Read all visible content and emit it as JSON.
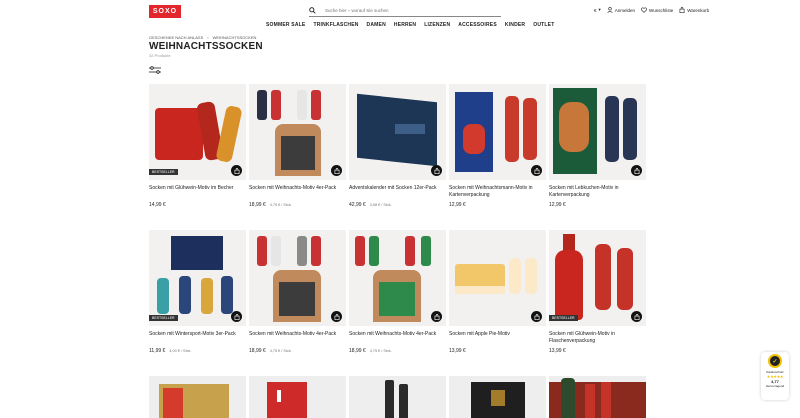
{
  "header": {
    "logo": "SOXO",
    "search_placeholder": "Suche hier – worauf Sie suchen",
    "currency": "€",
    "login": "Anmelden",
    "wishlist": "Wunschliste",
    "cart": "Warenkorb"
  },
  "nav": [
    "SOMMER SALE",
    "TRINKFLASCHEN",
    "DAMEN",
    "HERREN",
    "LIZENZEN",
    "ACCESSOIRES",
    "KINDER",
    "OUTLET"
  ],
  "breadcrumb": [
    "GESCHENKE NACH ANLASS",
    "WEIHNACHTSSOCKEN"
  ],
  "page_title": "WEIHNACHTSSOCKEN",
  "product_count": "32 Produkte",
  "colors": {
    "brand": "#e2262b",
    "bag": "#111111"
  },
  "products": [
    {
      "name": "Socken mit Glühwein-Motiv im Becher",
      "price": "14,99 €",
      "unit": "",
      "badge": "BESTSELLER"
    },
    {
      "name": "Socken mit Weihnachts-Motiv 4er-Pack",
      "price": "18,99 €",
      "unit": "4,75 € / Stck.",
      "badge": ""
    },
    {
      "name": "Adventskalender mit Socken 12er-Pack",
      "price": "42,99 €",
      "unit": "3,58 € / Stck.",
      "badge": ""
    },
    {
      "name": "Socken mit Weihnachtsmann-Motiv in Kartenverpackung",
      "price": "12,99 €",
      "unit": "",
      "badge": ""
    },
    {
      "name": "Socken mit Lebkuchen-Motiv in Kartenverpackung",
      "price": "12,99 €",
      "unit": "",
      "badge": ""
    },
    {
      "name": "Socken mit Wintersport-Motiv 3er-Pack",
      "price": "11,99 €",
      "unit": "4,00 € / Stck.",
      "badge": "BESTSELLER"
    },
    {
      "name": "Socken mit Weihnachts-Motiv 4er-Pack",
      "price": "18,99 €",
      "unit": "4,75 € / Stck.",
      "badge": ""
    },
    {
      "name": "Socken mit Weihnachts-Motiv 4er-Pack",
      "price": "18,99 €",
      "unit": "4,75 € / Stck.",
      "badge": ""
    },
    {
      "name": "Socken mit Apple Pie-Motiv",
      "price": "13,99 €",
      "unit": "",
      "badge": ""
    },
    {
      "name": "Socken mit Glühwein-Motiv in Flaschenverpackung",
      "price": "13,99 €",
      "unit": "",
      "badge": "BESTSELLER"
    }
  ],
  "trust_badge": {
    "label": "Käuferschutz",
    "rating": "4,77",
    "rating_label": "Hervorragend"
  }
}
